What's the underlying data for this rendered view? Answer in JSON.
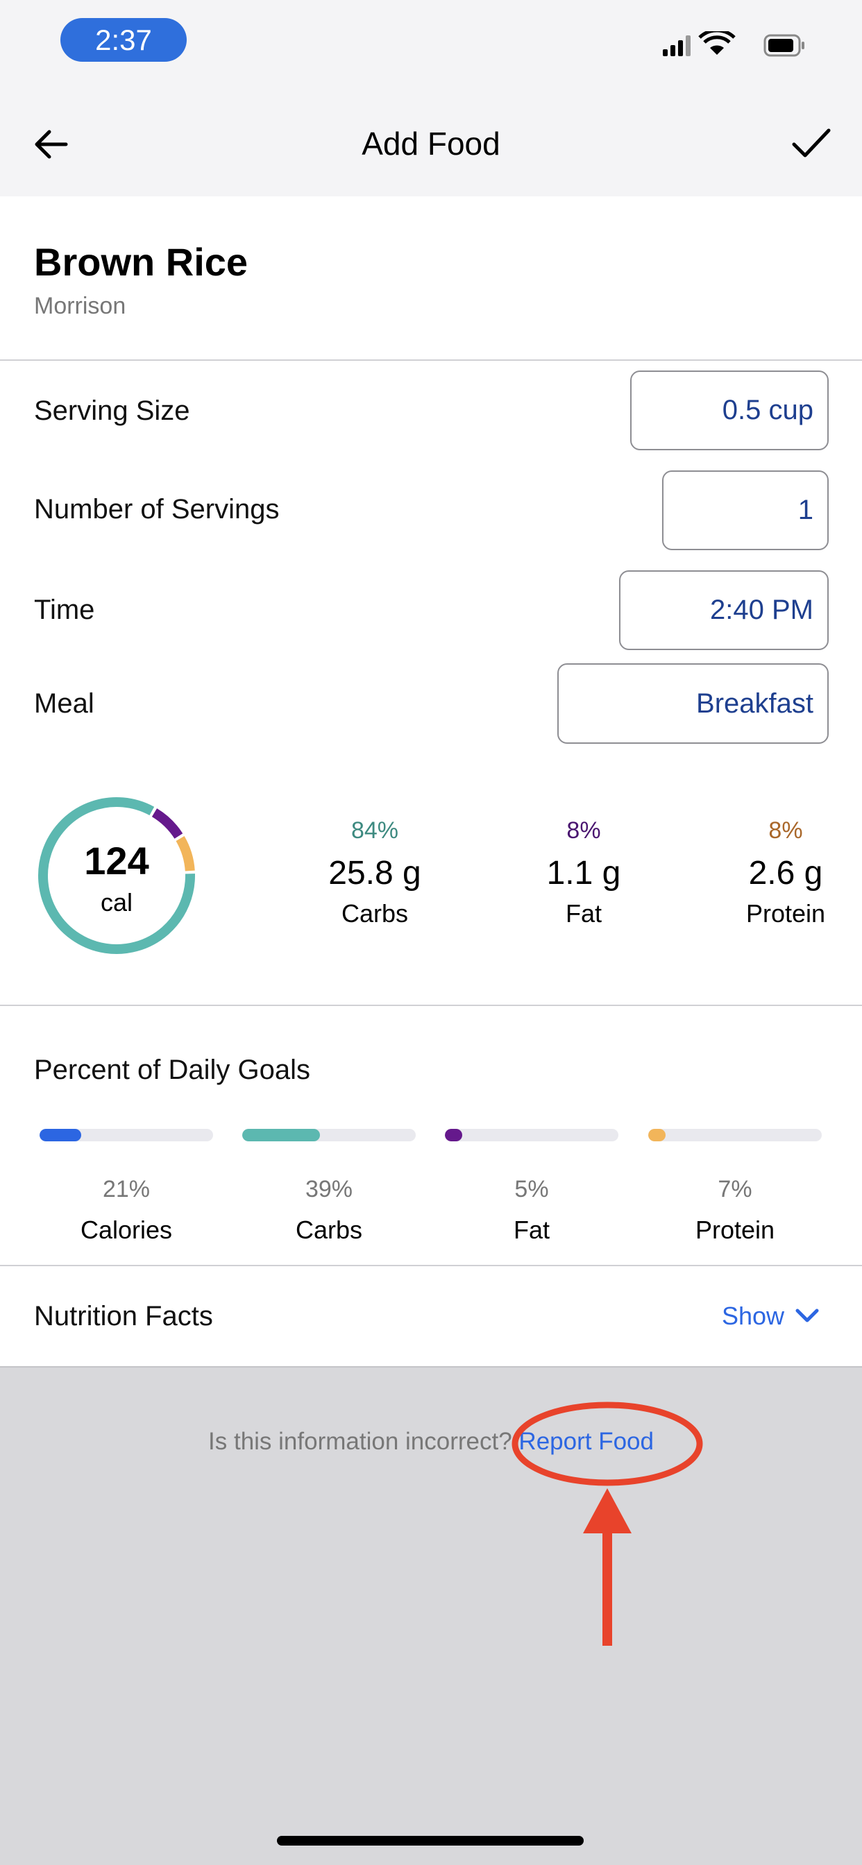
{
  "status": {
    "time": "2:37"
  },
  "nav": {
    "title": "Add Food",
    "back_icon": "arrow-left-icon",
    "confirm_icon": "checkmark-icon"
  },
  "food": {
    "name": "Brown Rice",
    "brand": "Morrison"
  },
  "fields": [
    {
      "label": "Serving Size",
      "value": "0.5 cup"
    },
    {
      "label": "Number of Servings",
      "value": "1"
    },
    {
      "label": "Time",
      "value": "2:40 PM"
    },
    {
      "label": "Meal",
      "value": "Breakfast"
    }
  ],
  "summary": {
    "calories": "124",
    "calories_unit": "cal",
    "macros": [
      {
        "pct": "84%",
        "value": "25.8 g",
        "label": "Carbs",
        "color": "#3d8a80",
        "ring_color": "#5cb8b0",
        "share": 84
      },
      {
        "pct": "8%",
        "value": "1.1 g",
        "label": "Fat",
        "color": "#4a1670",
        "ring_color": "#65198c",
        "share": 8
      },
      {
        "pct": "8%",
        "value": "2.6 g",
        "label": "Protein",
        "color": "#a9672a",
        "ring_color": "#f2b55a",
        "share": 8
      }
    ]
  },
  "goals": {
    "title": "Percent of Daily Goals",
    "items": [
      {
        "pct": "21%",
        "label": "Calories",
        "color": "#2c66e2",
        "fill": 21
      },
      {
        "pct": "39%",
        "label": "Carbs",
        "color": "#5cb8b0",
        "fill": 39
      },
      {
        "pct": "5%",
        "label": "Fat",
        "color": "#65198c",
        "fill": 5
      },
      {
        "pct": "7%",
        "label": "Protein",
        "color": "#f2b55a",
        "fill": 7
      }
    ]
  },
  "nutrition": {
    "title": "Nutrition Facts",
    "toggle": "Show"
  },
  "report": {
    "question": "Is this information incorrect?",
    "link": "Report Food"
  }
}
